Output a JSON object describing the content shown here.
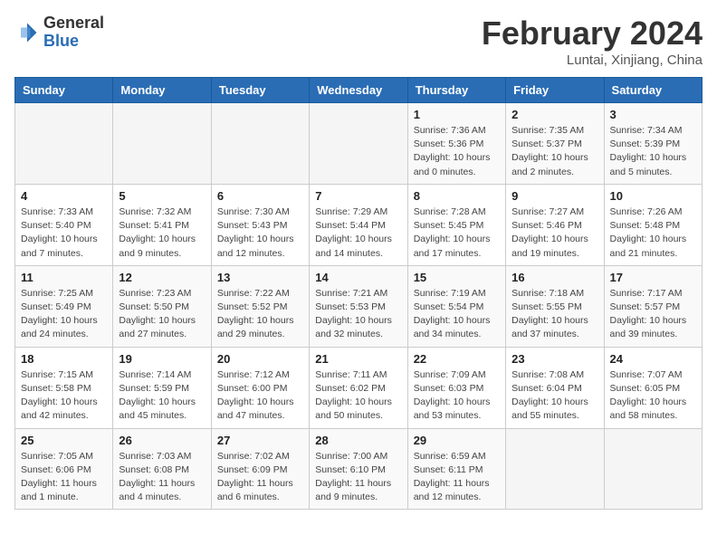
{
  "header": {
    "logo_general": "General",
    "logo_blue": "Blue",
    "month_title": "February 2024",
    "location": "Luntai, Xinjiang, China"
  },
  "calendar": {
    "headers": [
      "Sunday",
      "Monday",
      "Tuesday",
      "Wednesday",
      "Thursday",
      "Friday",
      "Saturday"
    ],
    "weeks": [
      [
        {
          "day": "",
          "info": ""
        },
        {
          "day": "",
          "info": ""
        },
        {
          "day": "",
          "info": ""
        },
        {
          "day": "",
          "info": ""
        },
        {
          "day": "1",
          "info": "Sunrise: 7:36 AM\nSunset: 5:36 PM\nDaylight: 10 hours\nand 0 minutes."
        },
        {
          "day": "2",
          "info": "Sunrise: 7:35 AM\nSunset: 5:37 PM\nDaylight: 10 hours\nand 2 minutes."
        },
        {
          "day": "3",
          "info": "Sunrise: 7:34 AM\nSunset: 5:39 PM\nDaylight: 10 hours\nand 5 minutes."
        }
      ],
      [
        {
          "day": "4",
          "info": "Sunrise: 7:33 AM\nSunset: 5:40 PM\nDaylight: 10 hours\nand 7 minutes."
        },
        {
          "day": "5",
          "info": "Sunrise: 7:32 AM\nSunset: 5:41 PM\nDaylight: 10 hours\nand 9 minutes."
        },
        {
          "day": "6",
          "info": "Sunrise: 7:30 AM\nSunset: 5:43 PM\nDaylight: 10 hours\nand 12 minutes."
        },
        {
          "day": "7",
          "info": "Sunrise: 7:29 AM\nSunset: 5:44 PM\nDaylight: 10 hours\nand 14 minutes."
        },
        {
          "day": "8",
          "info": "Sunrise: 7:28 AM\nSunset: 5:45 PM\nDaylight: 10 hours\nand 17 minutes."
        },
        {
          "day": "9",
          "info": "Sunrise: 7:27 AM\nSunset: 5:46 PM\nDaylight: 10 hours\nand 19 minutes."
        },
        {
          "day": "10",
          "info": "Sunrise: 7:26 AM\nSunset: 5:48 PM\nDaylight: 10 hours\nand 21 minutes."
        }
      ],
      [
        {
          "day": "11",
          "info": "Sunrise: 7:25 AM\nSunset: 5:49 PM\nDaylight: 10 hours\nand 24 minutes."
        },
        {
          "day": "12",
          "info": "Sunrise: 7:23 AM\nSunset: 5:50 PM\nDaylight: 10 hours\nand 27 minutes."
        },
        {
          "day": "13",
          "info": "Sunrise: 7:22 AM\nSunset: 5:52 PM\nDaylight: 10 hours\nand 29 minutes."
        },
        {
          "day": "14",
          "info": "Sunrise: 7:21 AM\nSunset: 5:53 PM\nDaylight: 10 hours\nand 32 minutes."
        },
        {
          "day": "15",
          "info": "Sunrise: 7:19 AM\nSunset: 5:54 PM\nDaylight: 10 hours\nand 34 minutes."
        },
        {
          "day": "16",
          "info": "Sunrise: 7:18 AM\nSunset: 5:55 PM\nDaylight: 10 hours\nand 37 minutes."
        },
        {
          "day": "17",
          "info": "Sunrise: 7:17 AM\nSunset: 5:57 PM\nDaylight: 10 hours\nand 39 minutes."
        }
      ],
      [
        {
          "day": "18",
          "info": "Sunrise: 7:15 AM\nSunset: 5:58 PM\nDaylight: 10 hours\nand 42 minutes."
        },
        {
          "day": "19",
          "info": "Sunrise: 7:14 AM\nSunset: 5:59 PM\nDaylight: 10 hours\nand 45 minutes."
        },
        {
          "day": "20",
          "info": "Sunrise: 7:12 AM\nSunset: 6:00 PM\nDaylight: 10 hours\nand 47 minutes."
        },
        {
          "day": "21",
          "info": "Sunrise: 7:11 AM\nSunset: 6:02 PM\nDaylight: 10 hours\nand 50 minutes."
        },
        {
          "day": "22",
          "info": "Sunrise: 7:09 AM\nSunset: 6:03 PM\nDaylight: 10 hours\nand 53 minutes."
        },
        {
          "day": "23",
          "info": "Sunrise: 7:08 AM\nSunset: 6:04 PM\nDaylight: 10 hours\nand 55 minutes."
        },
        {
          "day": "24",
          "info": "Sunrise: 7:07 AM\nSunset: 6:05 PM\nDaylight: 10 hours\nand 58 minutes."
        }
      ],
      [
        {
          "day": "25",
          "info": "Sunrise: 7:05 AM\nSunset: 6:06 PM\nDaylight: 11 hours\nand 1 minute."
        },
        {
          "day": "26",
          "info": "Sunrise: 7:03 AM\nSunset: 6:08 PM\nDaylight: 11 hours\nand 4 minutes."
        },
        {
          "day": "27",
          "info": "Sunrise: 7:02 AM\nSunset: 6:09 PM\nDaylight: 11 hours\nand 6 minutes."
        },
        {
          "day": "28",
          "info": "Sunrise: 7:00 AM\nSunset: 6:10 PM\nDaylight: 11 hours\nand 9 minutes."
        },
        {
          "day": "29",
          "info": "Sunrise: 6:59 AM\nSunset: 6:11 PM\nDaylight: 11 hours\nand 12 minutes."
        },
        {
          "day": "",
          "info": ""
        },
        {
          "day": "",
          "info": ""
        }
      ]
    ]
  }
}
